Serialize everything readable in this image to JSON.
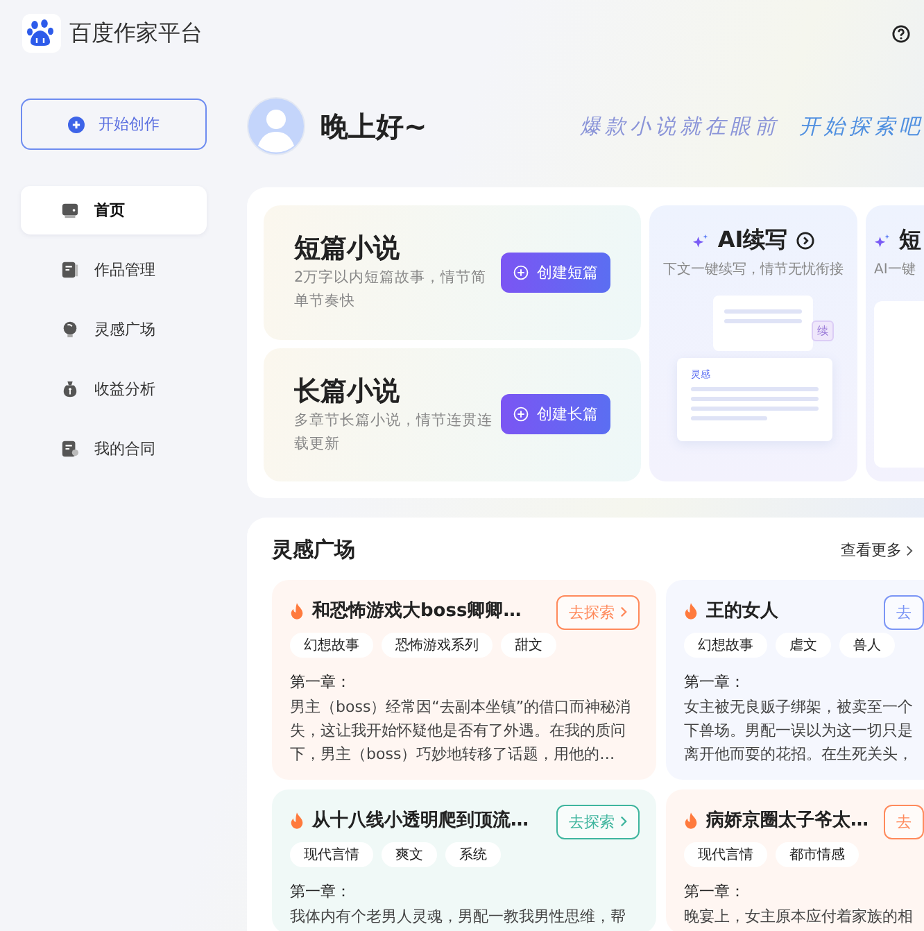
{
  "header": {
    "logo_text": "百度作家平台"
  },
  "sidebar": {
    "create_button": "开始创作",
    "items": [
      {
        "label": "首页",
        "selected": true
      },
      {
        "label": "作品管理",
        "selected": false
      },
      {
        "label": "灵感广场",
        "selected": false
      },
      {
        "label": "收益分析",
        "selected": false
      },
      {
        "label": "我的合同",
        "selected": false
      }
    ]
  },
  "greeting": {
    "text": "晚上好~",
    "slogan": [
      "爆款小说就在眼前",
      "开始探索吧"
    ]
  },
  "create_cards": [
    {
      "title": "短篇小说",
      "desc": "2万字以内短篇故事，情节简单节奏快",
      "button": "创建短篇"
    },
    {
      "title": "长篇小说",
      "desc": "多章节长篇小说，情节连贯连载更新",
      "button": "创建长篇"
    }
  ],
  "ai_cards": [
    {
      "title": "AI续写",
      "desc": "下文一键续写，情节无忧衔接",
      "kind": "full",
      "illustration_tag": "续",
      "illustration_label": "灵感"
    },
    {
      "title": "短",
      "desc": "AI一键",
      "kind": "cut"
    }
  ],
  "inspiration": {
    "title": "灵感广场",
    "more": "查看更多",
    "cards": [
      {
        "title": "和恐怖游戏大boss卿卿…",
        "tags": [
          "幻想故事",
          "恐怖游戏系列",
          "甜文"
        ],
        "chapter": "第一章：",
        "excerpt": "男主（boss）经常因“去副本坐镇”的借口而神秘消失，这让我开始怀疑他是否有了外遇。在我的质问下，男主（boss）巧妙地转移了话题，用他的…",
        "button": "去探索",
        "color": "#ff8a5c"
      },
      {
        "title": "王的女人",
        "tags": [
          "幻想故事",
          "虐文",
          "兽人"
        ],
        "chapter": "第一章：",
        "excerpt": "女主被无良贩子绑架，被卖至一个下兽场。男配一误以为这一切只是离开他而耍的花招。在生死关头，",
        "button": "去",
        "color": "#7b95f5"
      },
      {
        "title": "从十八线小透明爬到顶流…",
        "tags": [
          "现代言情",
          "爽文",
          "系统"
        ],
        "chapter": "第一章：",
        "excerpt": "我体内有个老男人灵魂，男配一教我男性思维，帮",
        "button": "去探索",
        "color": "#3fb59e"
      },
      {
        "title": "病娇京圈太子爷太…",
        "tags": [
          "现代言情",
          "都市情感"
        ],
        "chapter": "第一章：",
        "excerpt": "晚宴上，女主原本应付着家族的相",
        "button": "去",
        "color": "#ff8a5c"
      }
    ]
  }
}
